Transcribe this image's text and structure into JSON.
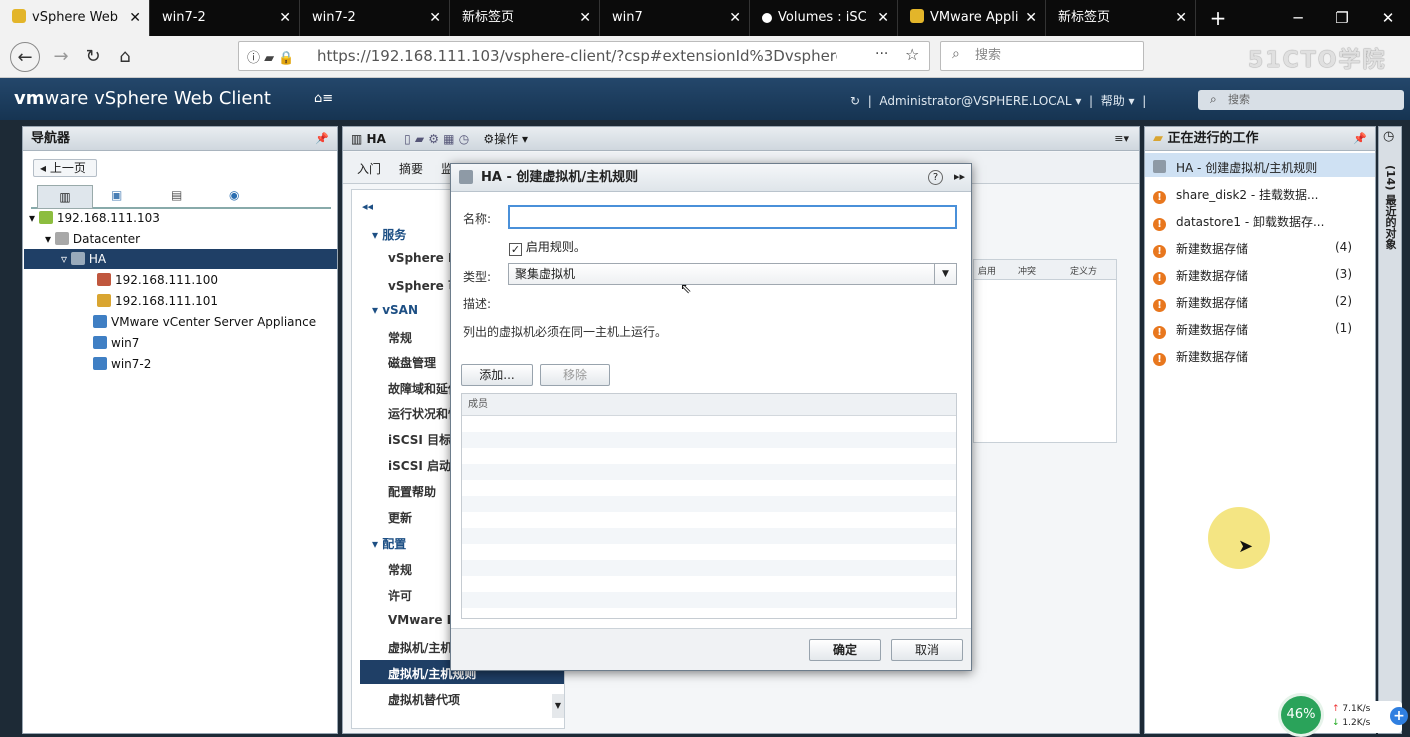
{
  "browser": {
    "tabs": [
      {
        "label": "vSphere Web",
        "active": true
      },
      {
        "label": "win7-2",
        "active": false
      },
      {
        "label": "win7-2",
        "active": false
      },
      {
        "label": "新标签页",
        "active": false
      },
      {
        "label": "win7",
        "active": false
      },
      {
        "label": "Volumes : iSC",
        "active": false
      },
      {
        "label": "VMware Appli",
        "active": false
      },
      {
        "label": "新标签页",
        "active": false
      }
    ],
    "new_tab": "+",
    "url": "https://192.168.111.103/vsphere-client/?csp#extensionId%3Dvsphere.core.c",
    "search_placeholder": "搜索",
    "watermark": "51CTO学院"
  },
  "vsphere": {
    "logo_brand": "vm",
    "logo_rest": "ware",
    "logo_product": " vSphere Web Client",
    "home": "⌂≡",
    "user": "Administrator@VSPHERE.LOCAL ▾",
    "help": "帮助 ▾",
    "search_placeholder": "搜索"
  },
  "navigator": {
    "title": "导航器",
    "back": "上一页",
    "tree": [
      {
        "label": "192.168.111.103",
        "level": 0
      },
      {
        "label": "Datacenter",
        "level": 1
      },
      {
        "label": "HA",
        "level": 2,
        "selected": true
      },
      {
        "label": "192.168.111.100",
        "level": 3
      },
      {
        "label": "192.168.111.101",
        "level": 3
      },
      {
        "label": "VMware vCenter Server Appliance",
        "level": 3
      },
      {
        "label": "win7",
        "level": 3
      },
      {
        "label": "win7-2",
        "level": 3
      }
    ]
  },
  "center": {
    "object": "HA",
    "actions": "操作 ▾",
    "tabs": [
      "入门",
      "摘要",
      "监"
    ],
    "sections": [
      {
        "header": "服务",
        "items": [
          "vSphere DRS",
          "vSphere 可用"
        ]
      },
      {
        "header": "vSAN",
        "items": [
          "常规",
          "磁盘管理",
          "故障域和延伸",
          "运行状况和性",
          "iSCSI 目标",
          "iSCSI 启动器",
          "配置帮助",
          "更新"
        ]
      },
      {
        "header": "配置",
        "items": [
          "常规",
          "许可",
          "VMware EVC",
          "虚拟机/主机组",
          "虚拟机/主机规则",
          "虚拟机替代项"
        ]
      }
    ],
    "table_headers": [
      "启用",
      "冲突",
      "定义方"
    ]
  },
  "dialog": {
    "title": "HA - 创建虚拟机/主机规则",
    "help": "?",
    "name_label": "名称:",
    "name_value": "",
    "enable_label": "启用规则。",
    "enable_checked": true,
    "type_label": "类型:",
    "type_value": "聚集虚拟机",
    "desc_label": "描述:",
    "desc_text": "列出的虚拟机必须在同一主机上运行。",
    "add": "添加...",
    "remove": "移除",
    "members_header": "成员",
    "ok": "确定",
    "cancel": "取消"
  },
  "work": {
    "title": "正在进行的工作",
    "items": [
      {
        "label": "HA - 创建虚拟机/主机规则",
        "count": "",
        "selected": true
      },
      {
        "label": "share_disk2 - 挂载数据...",
        "count": ""
      },
      {
        "label": "datastore1 - 卸载数据存...",
        "count": ""
      },
      {
        "label": "新建数据存储",
        "count": "(4)"
      },
      {
        "label": "新建数据存储",
        "count": "(3)"
      },
      {
        "label": "新建数据存储",
        "count": "(2)"
      },
      {
        "label": "新建数据存储",
        "count": "(1)"
      },
      {
        "label": "新建数据存储",
        "count": ""
      }
    ],
    "side_label": "(14) 最近的对象"
  },
  "netspeed": {
    "percent": "46%",
    "up": "7.1K/s",
    "down": "1.2K/s"
  },
  "colors": {
    "header": "#1f3f66",
    "selection": "#1f3f66",
    "warn": "#e8771e"
  }
}
